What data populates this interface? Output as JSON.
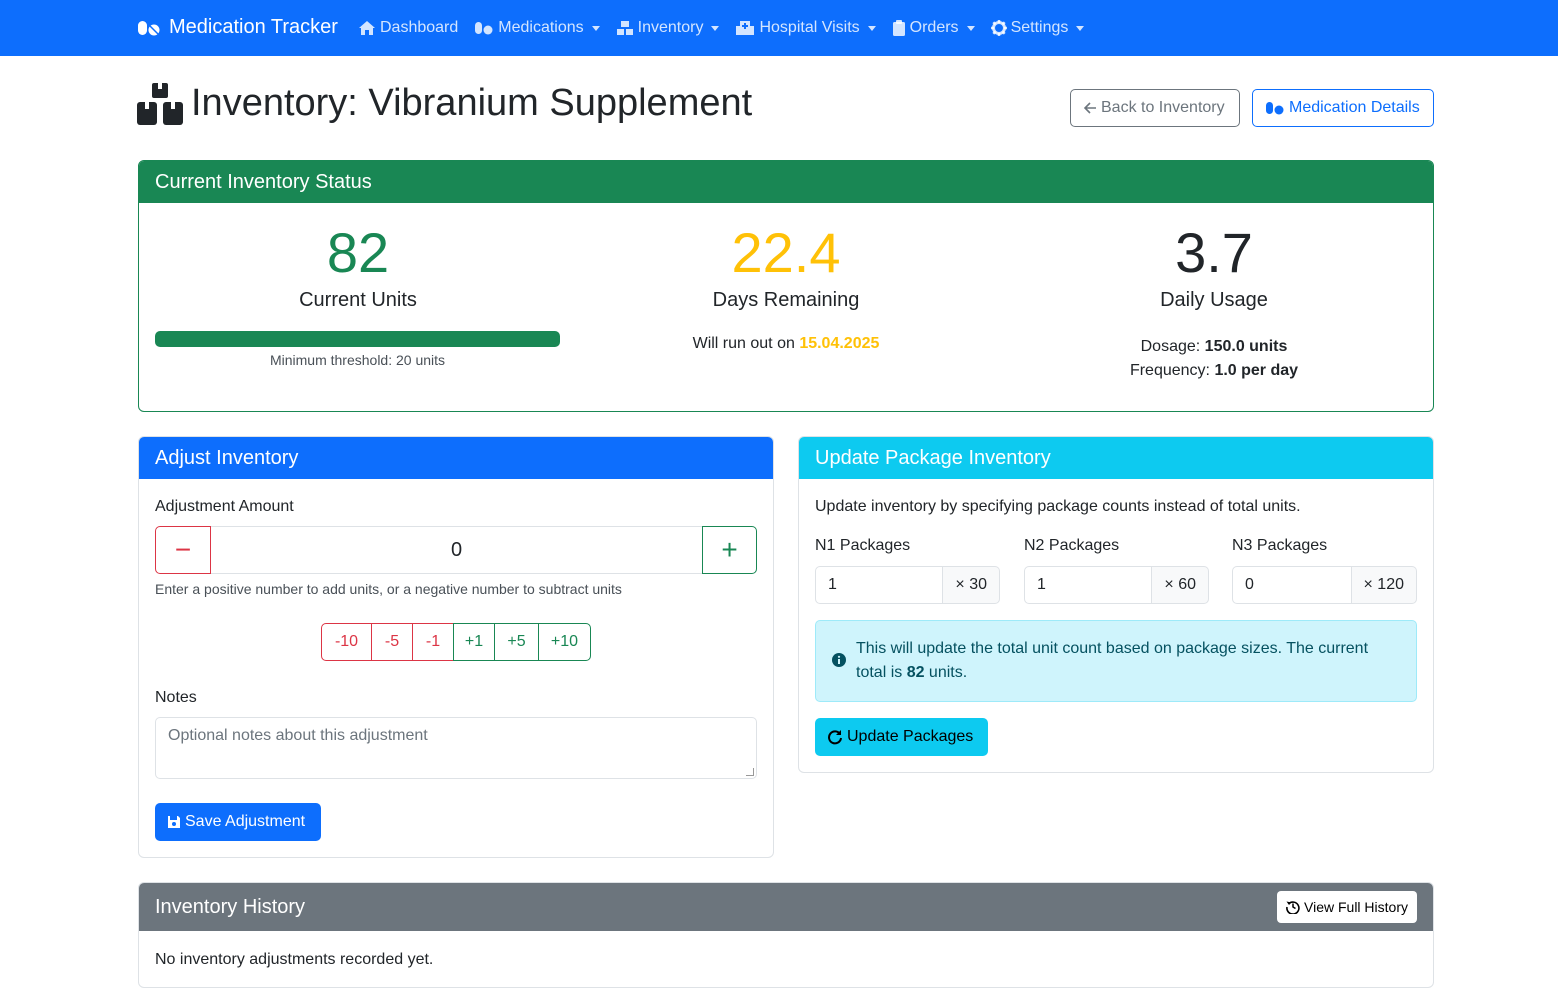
{
  "nav": {
    "brand": "Medication Tracker",
    "items": [
      {
        "label": "Dashboard",
        "icon": "home-icon",
        "dropdown": false
      },
      {
        "label": "Medications",
        "icon": "pills-icon",
        "dropdown": true
      },
      {
        "label": "Inventory",
        "icon": "boxes-icon",
        "dropdown": true
      },
      {
        "label": "Hospital Visits",
        "icon": "hospital-icon",
        "dropdown": true
      },
      {
        "label": "Orders",
        "icon": "clipboard-icon",
        "dropdown": true
      },
      {
        "label": "Settings",
        "icon": "gear-icon",
        "dropdown": true
      }
    ]
  },
  "header": {
    "title": "Inventory: Vibranium Supplement",
    "back_label": "Back to Inventory",
    "details_label": "Medication Details"
  },
  "status": {
    "title": "Current Inventory Status",
    "current_units": "82",
    "current_units_label": "Current Units",
    "progress_fraction": 1.0,
    "threshold_text": "Minimum threshold: 20 units",
    "days_remaining": "22.4",
    "days_remaining_label": "Days Remaining",
    "runout_prefix": "Will run out on ",
    "runout_date": "15.04.2025",
    "daily_usage": "3.7",
    "daily_usage_label": "Daily Usage",
    "dosage_label": "Dosage: ",
    "dosage_value": "150.0 units",
    "frequency_label": "Frequency: ",
    "frequency_value": "1.0 per day"
  },
  "adjust": {
    "title": "Adjust Inventory",
    "amount_label": "Adjustment Amount",
    "minus": "−",
    "amount_value": "0",
    "plus": "+",
    "help": "Enter a positive number to add units, or a negative number to subtract units",
    "quick": [
      "-10",
      "-5",
      "-1",
      "+1",
      "+5",
      "+10"
    ],
    "notes_label": "Notes",
    "notes_placeholder": "Optional notes about this adjustment",
    "save_label": "Save Adjustment"
  },
  "packages": {
    "title": "Update Package Inventory",
    "intro": "Update inventory by specifying package counts instead of total units.",
    "groups": [
      {
        "label": "N1 Packages",
        "value": "1",
        "mult": "× 30"
      },
      {
        "label": "N2 Packages",
        "value": "1",
        "mult": "× 60"
      },
      {
        "label": "N3 Packages",
        "value": "0",
        "mult": "× 120"
      }
    ],
    "info_text": "This will update the total unit count based on package sizes. The current total is ",
    "info_total": "82",
    "info_suffix": " units.",
    "update_label": "Update Packages"
  },
  "history": {
    "title": "Inventory History",
    "view_label": "View Full History",
    "empty": "No inventory adjustments recorded yet."
  },
  "colors": {
    "primary": "#0d6efd",
    "success": "#198754",
    "warning": "#ffc107",
    "info": "#0dcaf0",
    "secondary": "#6c757d",
    "danger": "#dc3545"
  }
}
